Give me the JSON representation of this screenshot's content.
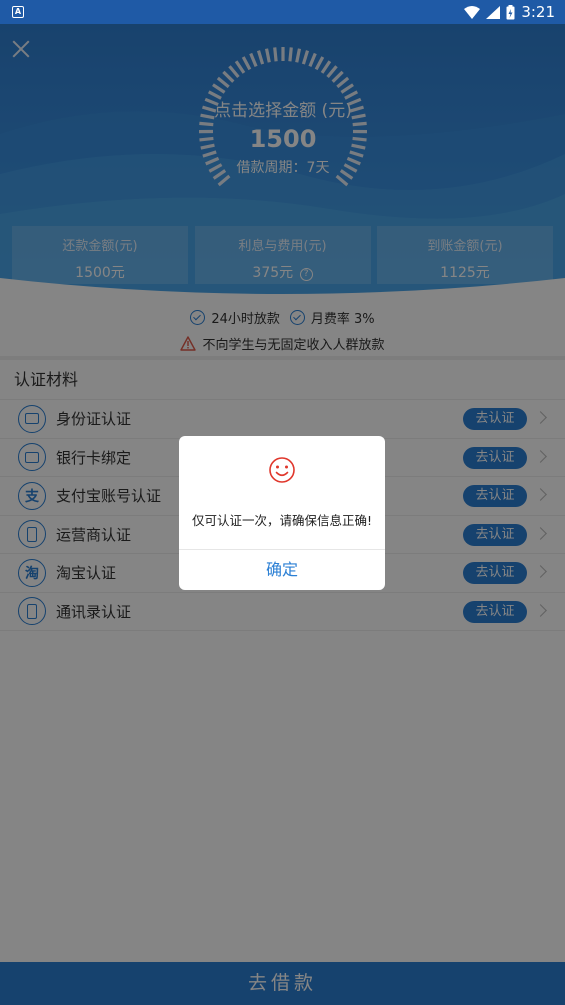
{
  "status_bar": {
    "time": "3:21"
  },
  "header": {
    "dial_title": "点击选择金额 (元)",
    "amount": "1500",
    "period": "借款周期：7天",
    "stats": [
      {
        "label": "还款金额(元)",
        "value": "1500元"
      },
      {
        "label": "利息与费用(元)",
        "value": "375元"
      },
      {
        "label": "到账金额(元)",
        "value": "1125元"
      }
    ]
  },
  "notices": {
    "fast_loan": "24小时放款",
    "monthly_rate": "月费率 3%",
    "warning": "不向学生与无固定收入人群放款"
  },
  "materials": {
    "title": "认证材料",
    "items": [
      {
        "label": "身份证认证",
        "button": "去认证",
        "icon": "id-card-icon"
      },
      {
        "label": "银行卡绑定",
        "button": "去认证",
        "icon": "bank-card-icon"
      },
      {
        "label": "支付宝账号认证",
        "button": "去认证",
        "icon": "alipay-icon",
        "glyph": "支"
      },
      {
        "label": "运营商认证",
        "button": "去认证",
        "icon": "phone-icon"
      },
      {
        "label": "淘宝认证",
        "button": "去认证",
        "icon": "taobao-icon",
        "glyph": "淘"
      },
      {
        "label": "通讯录认证",
        "button": "去认证",
        "icon": "contacts-icon"
      }
    ]
  },
  "dialog": {
    "message": "仅可认证一次，请确保信息正确!",
    "confirm": "确定"
  },
  "bottom_bar": {
    "label": "去借款"
  },
  "colors": {
    "primary": "#2b7fd4",
    "header": "#3a8fdf",
    "warning": "#e05a4a"
  }
}
